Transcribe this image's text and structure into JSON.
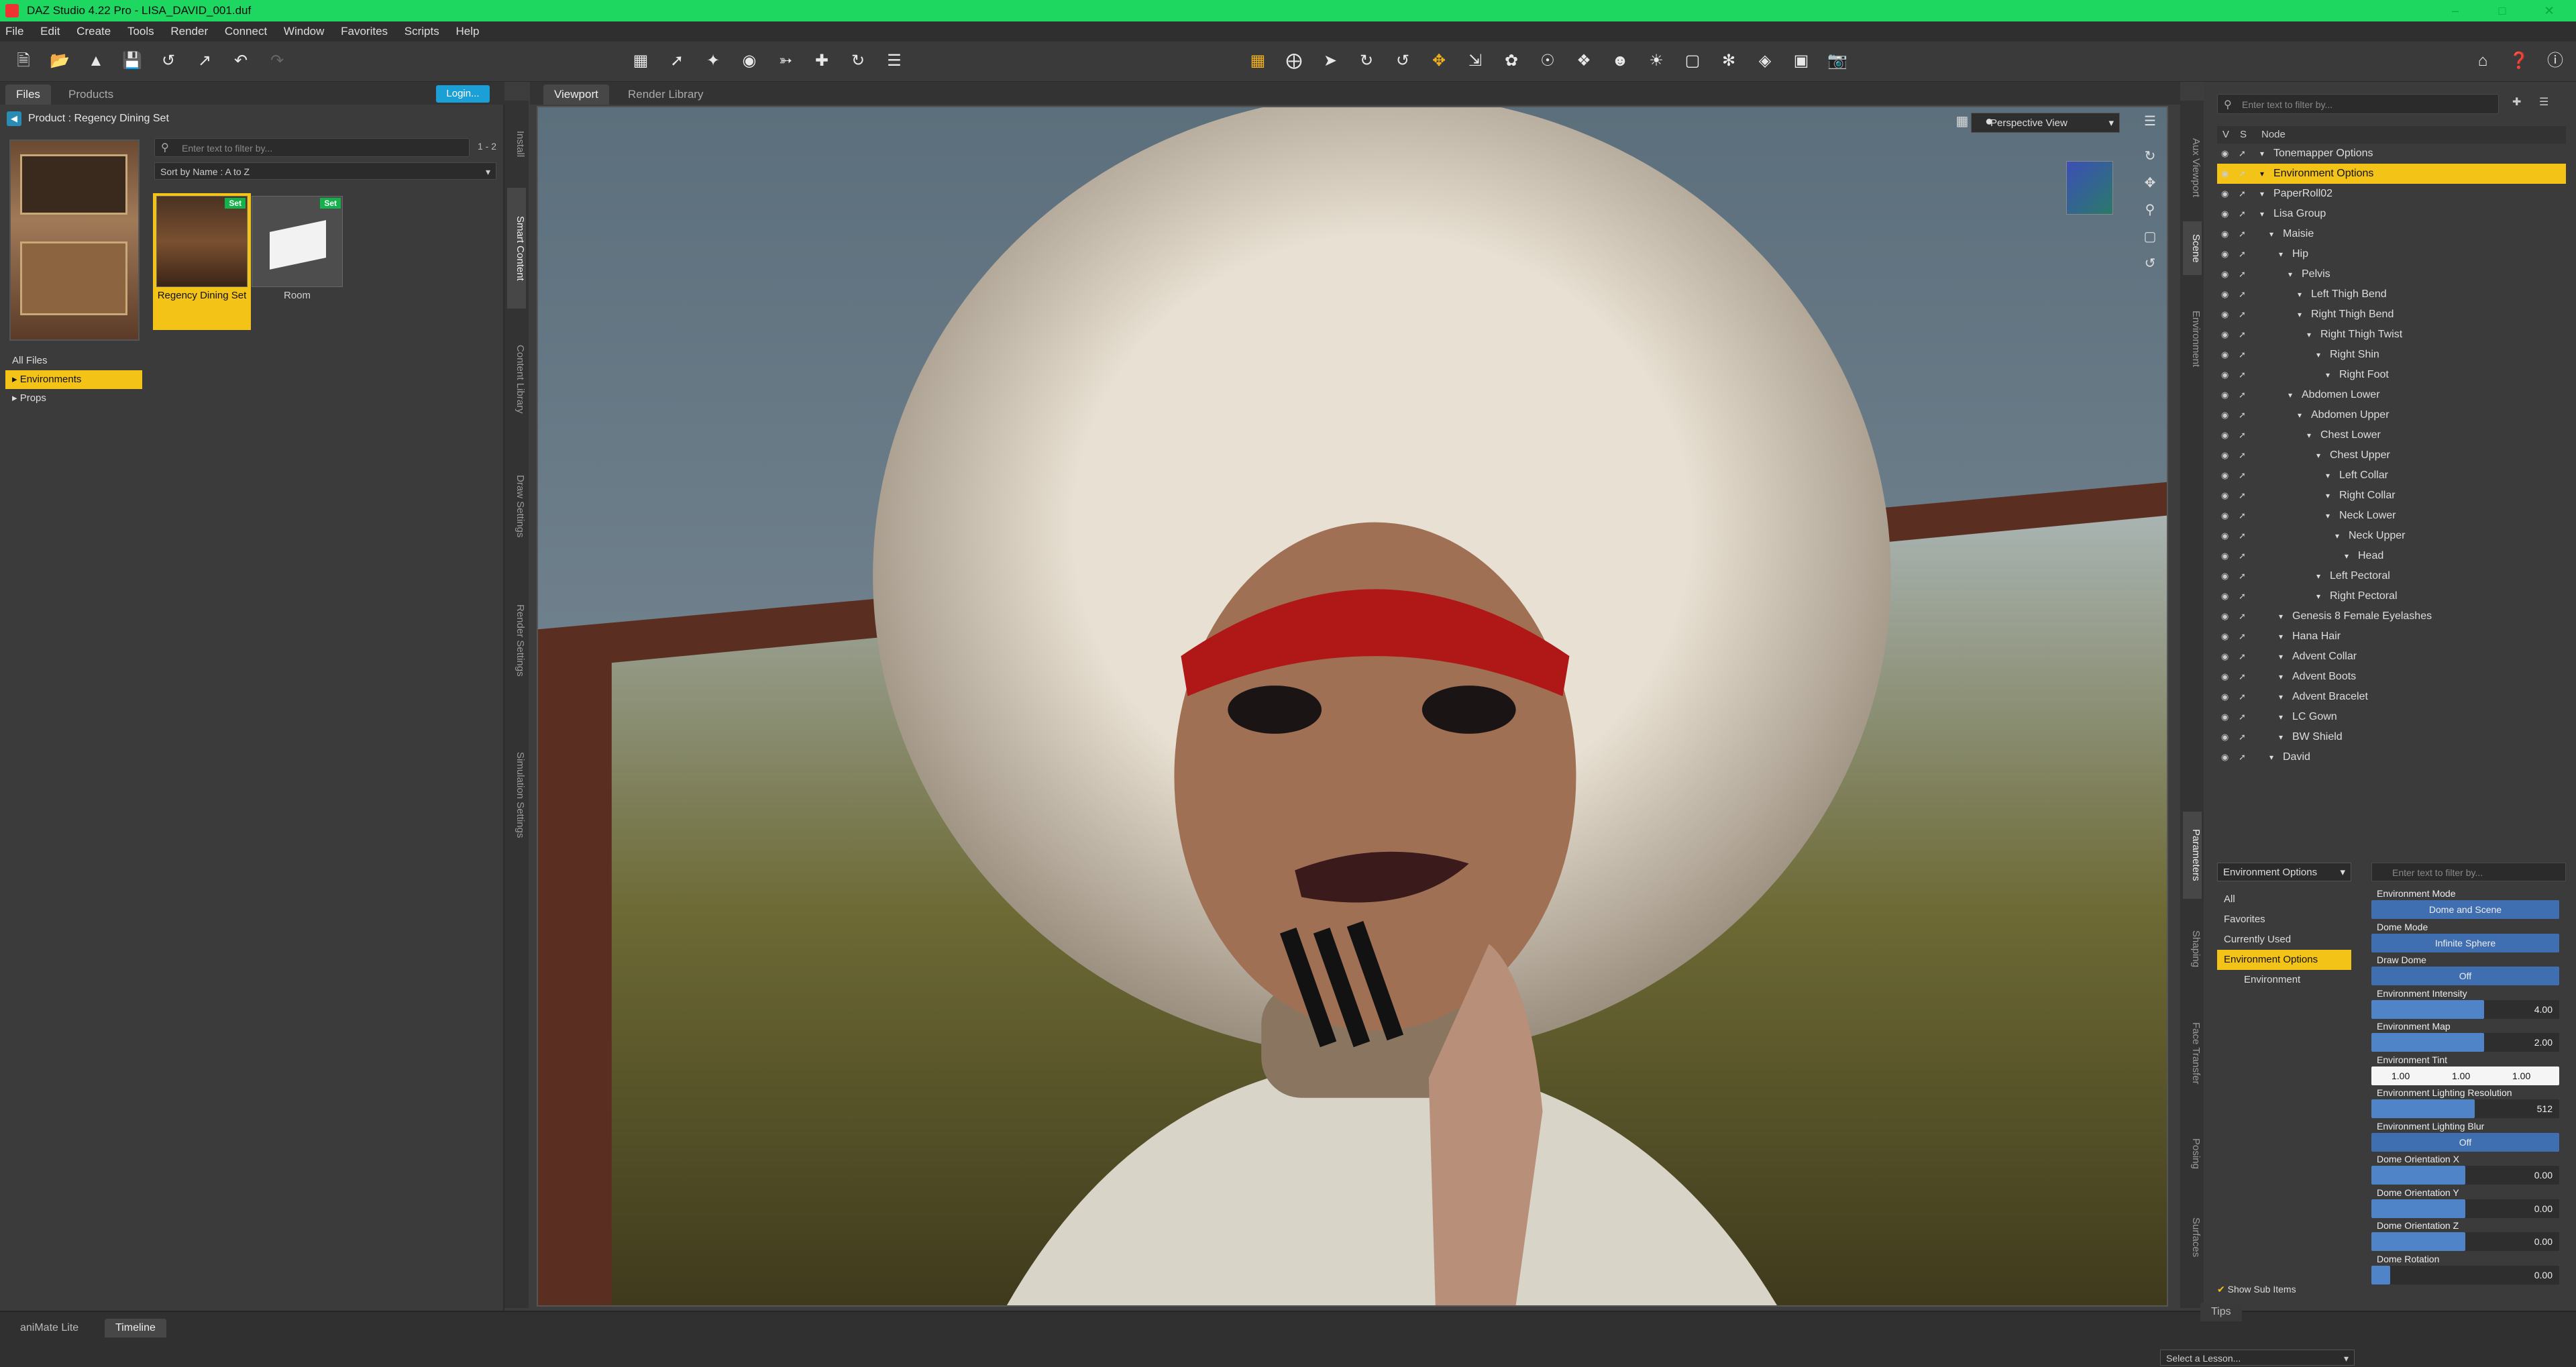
{
  "window": {
    "title": "DAZ Studio 4.22 Pro - LISA_DAVID_001.duf"
  },
  "menu": [
    "File",
    "Edit",
    "Create",
    "Tools",
    "Render",
    "Connect",
    "Window",
    "Favorites",
    "Scripts",
    "Help"
  ],
  "content_panel": {
    "tabs": [
      "Files",
      "Products"
    ],
    "login_label": "Login...",
    "breadcrumb": "Product : Regency Dining Set",
    "filter_placeholder": "Enter text to filter by...",
    "page_count": "1 - 2",
    "sort_label": "Sort by Name : A to Z",
    "folders": [
      "All Files",
      "Environments",
      "Props"
    ],
    "assets": [
      {
        "name": "Regency Dining Set",
        "badge": "Set"
      },
      {
        "name": "Room",
        "badge": "Set"
      }
    ]
  },
  "left_side_tabs": [
    "Install",
    "Smart Content",
    "Content Library",
    "Draw Settings",
    "Render Settings",
    "Simulation Settings"
  ],
  "viewport": {
    "tabs": [
      "Viewport",
      "Render Library"
    ],
    "camera": "Perspective View"
  },
  "right_side_tabs": [
    "Aux Viewport",
    "Scene",
    "Environment",
    "Parameters",
    "Shaping",
    "Face Transfer",
    "Posing",
    "Surfaces"
  ],
  "scene": {
    "filter_placeholder": "Enter text to filter by...",
    "columns": {
      "v": "V",
      "s": "S",
      "node": "Node"
    },
    "nodes": [
      {
        "label": "Tonemapper Options",
        "depth": 0
      },
      {
        "label": "Environment Options",
        "depth": 0
      },
      {
        "label": "PaperRoll02",
        "depth": 0
      },
      {
        "label": "Lisa Group",
        "depth": 0
      },
      {
        "label": "Maisie",
        "depth": 1
      },
      {
        "label": "Hip",
        "depth": 2
      },
      {
        "label": "Pelvis",
        "depth": 3
      },
      {
        "label": "Left Thigh Bend",
        "depth": 4
      },
      {
        "label": "Right Thigh Bend",
        "depth": 4
      },
      {
        "label": "Right Thigh Twist",
        "depth": 5
      },
      {
        "label": "Right Shin",
        "depth": 6
      },
      {
        "label": "Right Foot",
        "depth": 7
      },
      {
        "label": "Abdomen Lower",
        "depth": 3
      },
      {
        "label": "Abdomen Upper",
        "depth": 4
      },
      {
        "label": "Chest Lower",
        "depth": 5
      },
      {
        "label": "Chest Upper",
        "depth": 6
      },
      {
        "label": "Left Collar",
        "depth": 7
      },
      {
        "label": "Right Collar",
        "depth": 7
      },
      {
        "label": "Neck Lower",
        "depth": 7
      },
      {
        "label": "Neck Upper",
        "depth": 8
      },
      {
        "label": "Head",
        "depth": 9
      },
      {
        "label": "Left Pectoral",
        "depth": 6
      },
      {
        "label": "Right Pectoral",
        "depth": 6
      },
      {
        "label": "Genesis 8 Female Eyelashes",
        "depth": 2
      },
      {
        "label": "Hana Hair",
        "depth": 2
      },
      {
        "label": "Advent Collar",
        "depth": 2
      },
      {
        "label": "Advent Boots",
        "depth": 2
      },
      {
        "label": "Advent Bracelet",
        "depth": 2
      },
      {
        "label": "LC Gown",
        "depth": 2
      },
      {
        "label": "BW Shield",
        "depth": 2
      },
      {
        "label": "David",
        "depth": 1
      }
    ]
  },
  "parameters": {
    "node_select": "Environment Options",
    "filter_placeholder": "Enter text to filter by...",
    "categories": [
      "All",
      "Favorites",
      "Currently Used",
      "Environment Options",
      "Environment"
    ],
    "show_sub_items": "Show Sub Items",
    "properties": [
      {
        "name": "Environment Mode",
        "value": "Dome and Scene"
      },
      {
        "name": "Dome Mode",
        "value": "Infinite Sphere"
      },
      {
        "name": "Draw Dome",
        "value": "Off"
      },
      {
        "name": "Environment Intensity",
        "value": "4.00",
        "level": 0.6
      },
      {
        "name": "Environment Map",
        "value": "2.00",
        "level": 0.6
      },
      {
        "name": "Environment Tint",
        "r": "1.00",
        "g": "1.00",
        "b": "1.00"
      },
      {
        "name": "Environment Lighting Resolution",
        "value": "512",
        "level": 0.55
      },
      {
        "name": "Environment Lighting Blur",
        "value": "Off"
      },
      {
        "name": "Dome Orientation X",
        "value": "0.00",
        "level": 0.5
      },
      {
        "name": "Dome Orientation Y",
        "value": "0.00",
        "level": 0.5
      },
      {
        "name": "Dome Orientation Z",
        "value": "0.00",
        "level": 0.5
      },
      {
        "name": "Dome Rotation",
        "value": "0.00",
        "level": 0.1
      }
    ]
  },
  "bottom": {
    "tabs": [
      "aniMate Lite",
      "Timeline"
    ],
    "tips_label": "Tips",
    "lesson_placeholder": "Select a Lesson..."
  }
}
